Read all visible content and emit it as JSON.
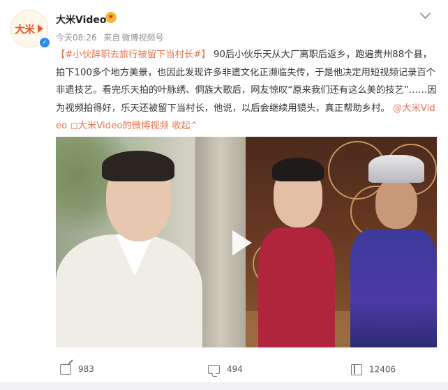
{
  "post": {
    "author": "大米Video",
    "avatar_text": "大米",
    "time": "今天08:26",
    "source_prefix": "来自",
    "source": "微博视频号",
    "hashtag": "#小伙辞职去旅行被留下当村长#",
    "bracket_open": "【",
    "bracket_close": "】",
    "body": "90后小伙乐天从大厂离职后返乡，跑遍贵州88个县，拍下100多个地方美景，也因此发现许多非遗文化正濒临失传，于是他决定用短视频记录百个非遗技艺。看完乐天拍的叶脉绣、侗族大歌后，网友惊叹“原来我们还有这么美的技艺”……因为视频拍得好，乐天还被留下当村长，他说，以后会继续用镜头，真正帮助乡村。",
    "mention": "@大米Video",
    "video_link": "大米Video的微博视频",
    "collapse": "收起"
  },
  "actions": {
    "share_count": "983",
    "comment_count": "494",
    "like_count": "12406"
  },
  "colors": {
    "accent": "#eb7350",
    "verify": "#2d8cf0"
  }
}
